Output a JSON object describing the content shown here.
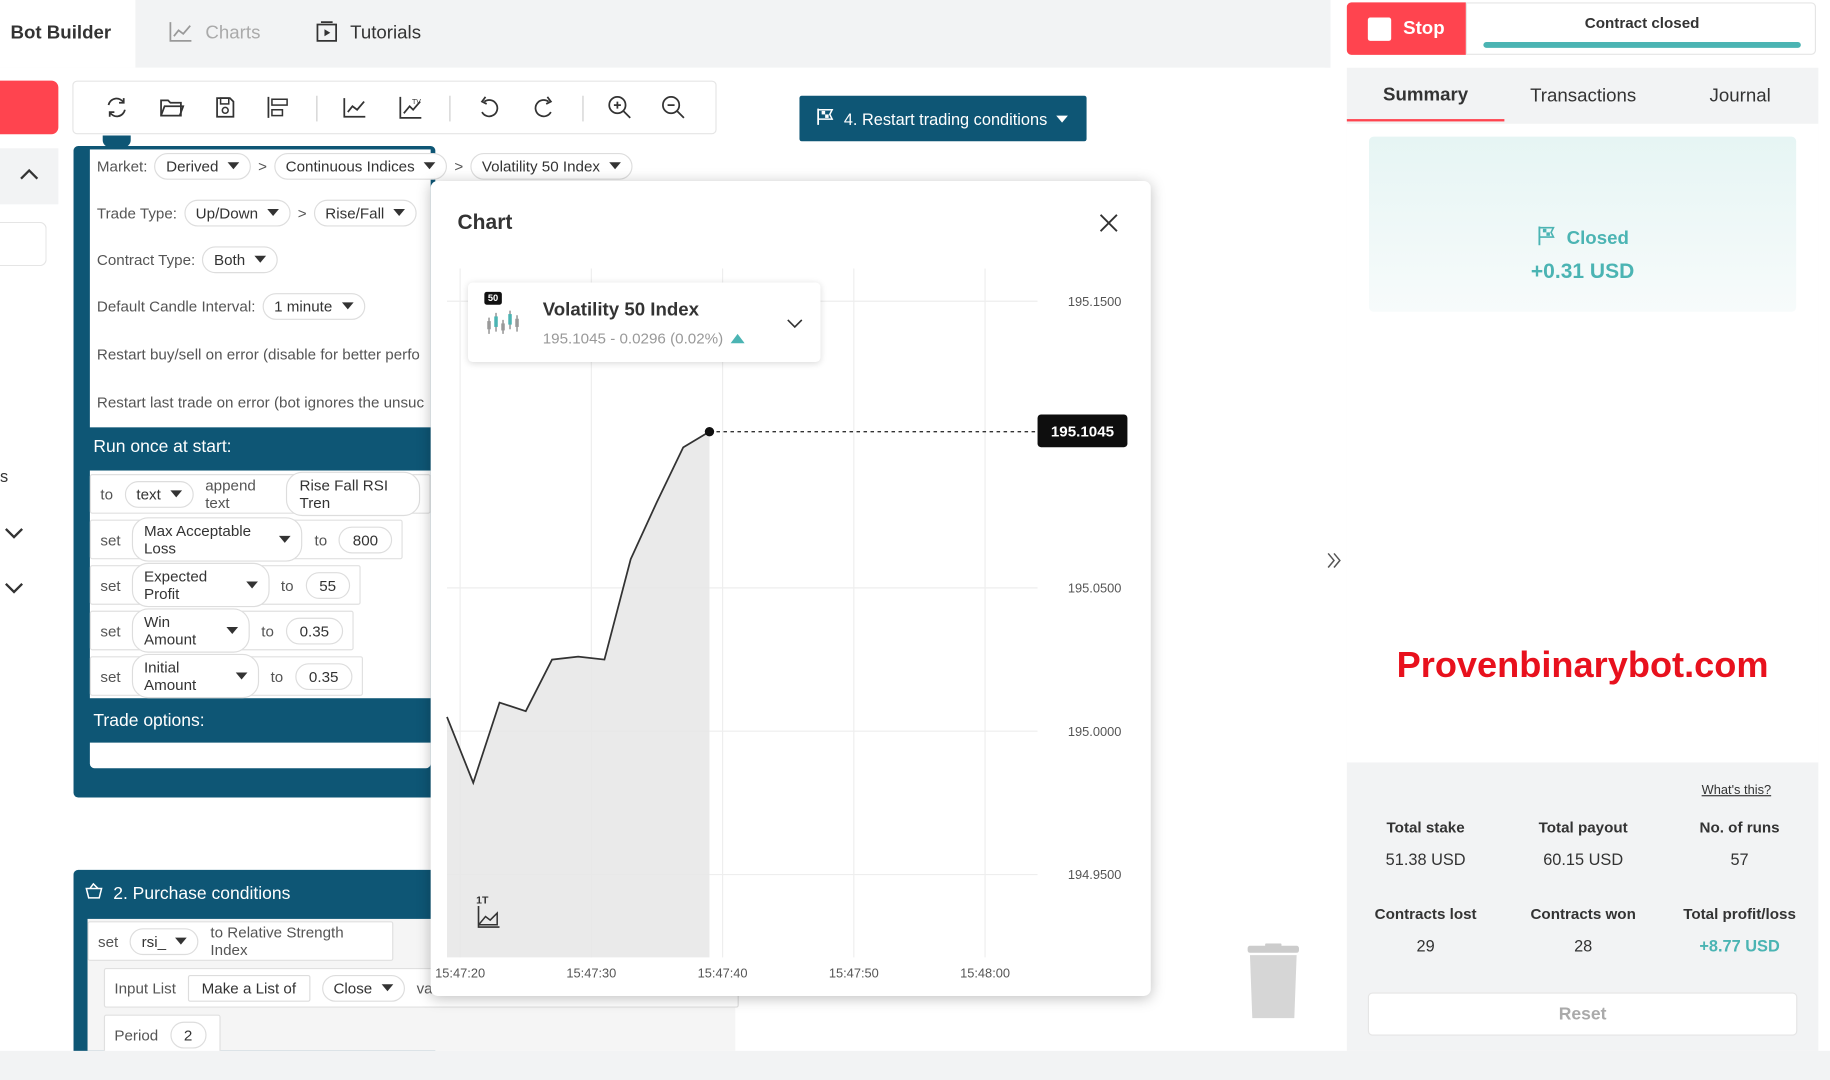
{
  "header": {
    "tabs": [
      {
        "label": "Bot Builder",
        "active": true,
        "icon": "none"
      },
      {
        "label": "Charts",
        "icon": "line-chart-icon"
      },
      {
        "label": "Tutorials",
        "icon": "play-tutorial-icon"
      }
    ]
  },
  "toolbar": {
    "icons": [
      "reset-icon",
      "open-folder-icon",
      "save-icon",
      "sort-blocks-icon",
      "chart-icon",
      "trading-view-icon",
      "undo-icon",
      "redo-icon",
      "zoom-in-icon",
      "zoom-out-icon"
    ],
    "restart_label": "4. Restart trading conditions"
  },
  "blocks": {
    "market_label": "Market:",
    "market_values": [
      "Derived",
      "Continuous Indices",
      "Volatility 50 Index"
    ],
    "trade_type_label": "Trade Type:",
    "trade_type_values": [
      "Up/Down",
      "Rise/Fall"
    ],
    "contract_type_label": "Contract Type:",
    "contract_type_value": "Both",
    "candle_label": "Default Candle Interval:",
    "candle_value": "1 minute",
    "restart_error_label": "Restart buy/sell on error (disable for better perfo",
    "restart_last_label": "Restart last trade on error (bot ignores the unsuc",
    "run_once_label": "Run once at start:",
    "run_rows": [
      {
        "kw": "to",
        "var": "text",
        "mid": "append text",
        "value": "Rise Fall RSI Tren"
      },
      {
        "kw": "set",
        "var": "Max Acceptable Loss",
        "mid": "to",
        "value": "800"
      },
      {
        "kw": "set",
        "var": "Expected Profit",
        "mid": "to",
        "value": "55"
      },
      {
        "kw": "set",
        "var": "Win Amount",
        "mid": "to",
        "value": "0.35"
      },
      {
        "kw": "set",
        "var": "Initial Amount",
        "mid": "to",
        "value": "0.35"
      }
    ],
    "trade_options_label": "Trade options:",
    "purchase_title": "2. Purchase conditions",
    "purchase_rows": {
      "set_kw": "set",
      "var": "rsi_",
      "rsi_text": "to Relative Strength Index",
      "input_list": "Input List",
      "make_list": "Make a List of",
      "close": "Close",
      "values": "values",
      "period": "Period",
      "period_value": "2"
    }
  },
  "chart_modal": {
    "title": "Chart",
    "badge": "50",
    "symbol": "Volatility 50 Index",
    "quote": "195.1045 - 0.0296 (0.02%)",
    "current_price": "195.1045",
    "interval_badge": "1T"
  },
  "chart_data": {
    "type": "area",
    "x": [
      "15:47:19",
      "15:47:21",
      "15:47:23",
      "15:47:25",
      "15:47:27",
      "15:47:29",
      "15:47:31",
      "15:47:33",
      "15:47:35",
      "15:47:37",
      "15:47:39"
    ],
    "y": [
      195.005,
      194.982,
      195.01,
      195.007,
      195.025,
      195.026,
      195.025,
      195.06,
      195.08,
      195.099,
      195.1045
    ],
    "xticks": [
      "15:47:20",
      "15:47:30",
      "15:47:40",
      "15:47:50",
      "15:48:00"
    ],
    "xtick_values": [
      20,
      30,
      40,
      50,
      60
    ],
    "yticks": [
      "195.1500",
      "195.0500",
      "195.0000",
      "194.9500"
    ],
    "ytick_values": [
      195.15,
      195.05,
      195.0,
      194.95
    ],
    "ylim": [
      194.95,
      195.15
    ],
    "xlim_seconds": [
      19,
      64
    ],
    "grid": true
  },
  "run_panel": {
    "stop_label": "Stop",
    "contract_status": "Contract closed",
    "tabs": [
      "Summary",
      "Transactions",
      "Journal"
    ],
    "closed_label": "Closed",
    "closed_profit": "+0.31 USD",
    "watermark": "Provenbinarybot.com",
    "whats_this": "What's this?",
    "stats": [
      {
        "label": "Total stake",
        "value": "51.38 USD"
      },
      {
        "label": "Total payout",
        "value": "60.15 USD"
      },
      {
        "label": "No. of runs",
        "value": "57"
      },
      {
        "label": "Contracts lost",
        "value": "29"
      },
      {
        "label": "Contracts won",
        "value": "28"
      },
      {
        "label": "Total profit/loss",
        "value": "+8.77 USD"
      }
    ],
    "reset_label": "Reset"
  },
  "colors": {
    "brand_red": "#ff444f",
    "block_blue": "#0e5675",
    "profit_green": "#4bb4b3",
    "watermark_red": "#e8111d"
  }
}
